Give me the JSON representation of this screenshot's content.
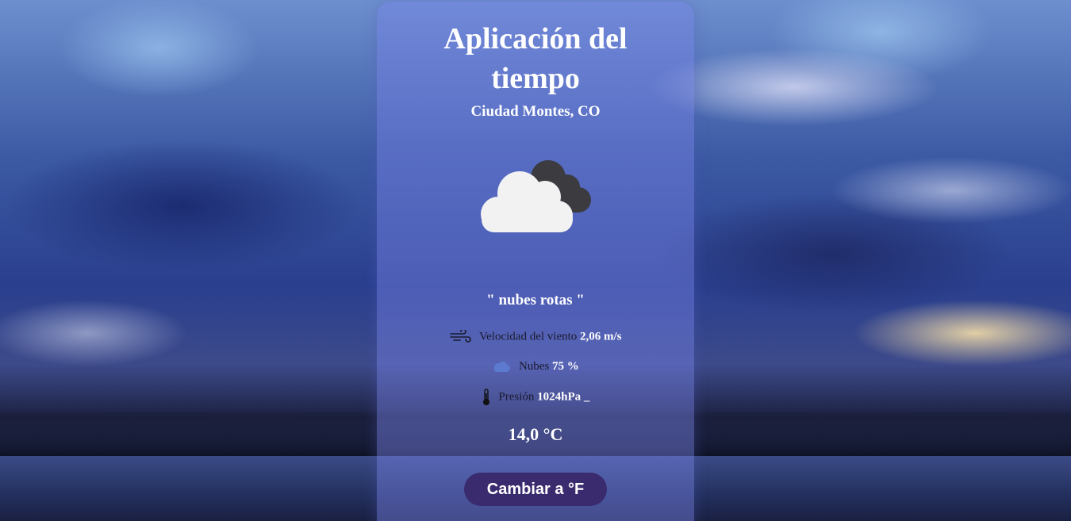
{
  "app": {
    "title": "Aplicación del tiempo",
    "city": "Ciudad Montes, CO"
  },
  "weather": {
    "icon": "broken-clouds-icon",
    "description": "\" nubes rotas \"",
    "wind": {
      "icon": "wind-icon",
      "label": "Velocidad del viento",
      "value": "2,06 m/s"
    },
    "clouds": {
      "icon": "clouds-icon",
      "label": "Nubes",
      "value": "75 %"
    },
    "pressure": {
      "icon": "thermometer-icon",
      "label": "Presión",
      "value": "1024hPa _"
    },
    "temperature": "14,0 °C"
  },
  "actions": {
    "toggle_unit_label": "Cambiar a °F"
  },
  "colors": {
    "card": "#7882e6",
    "button": "#3a2a6e",
    "text": "#ffffff"
  }
}
